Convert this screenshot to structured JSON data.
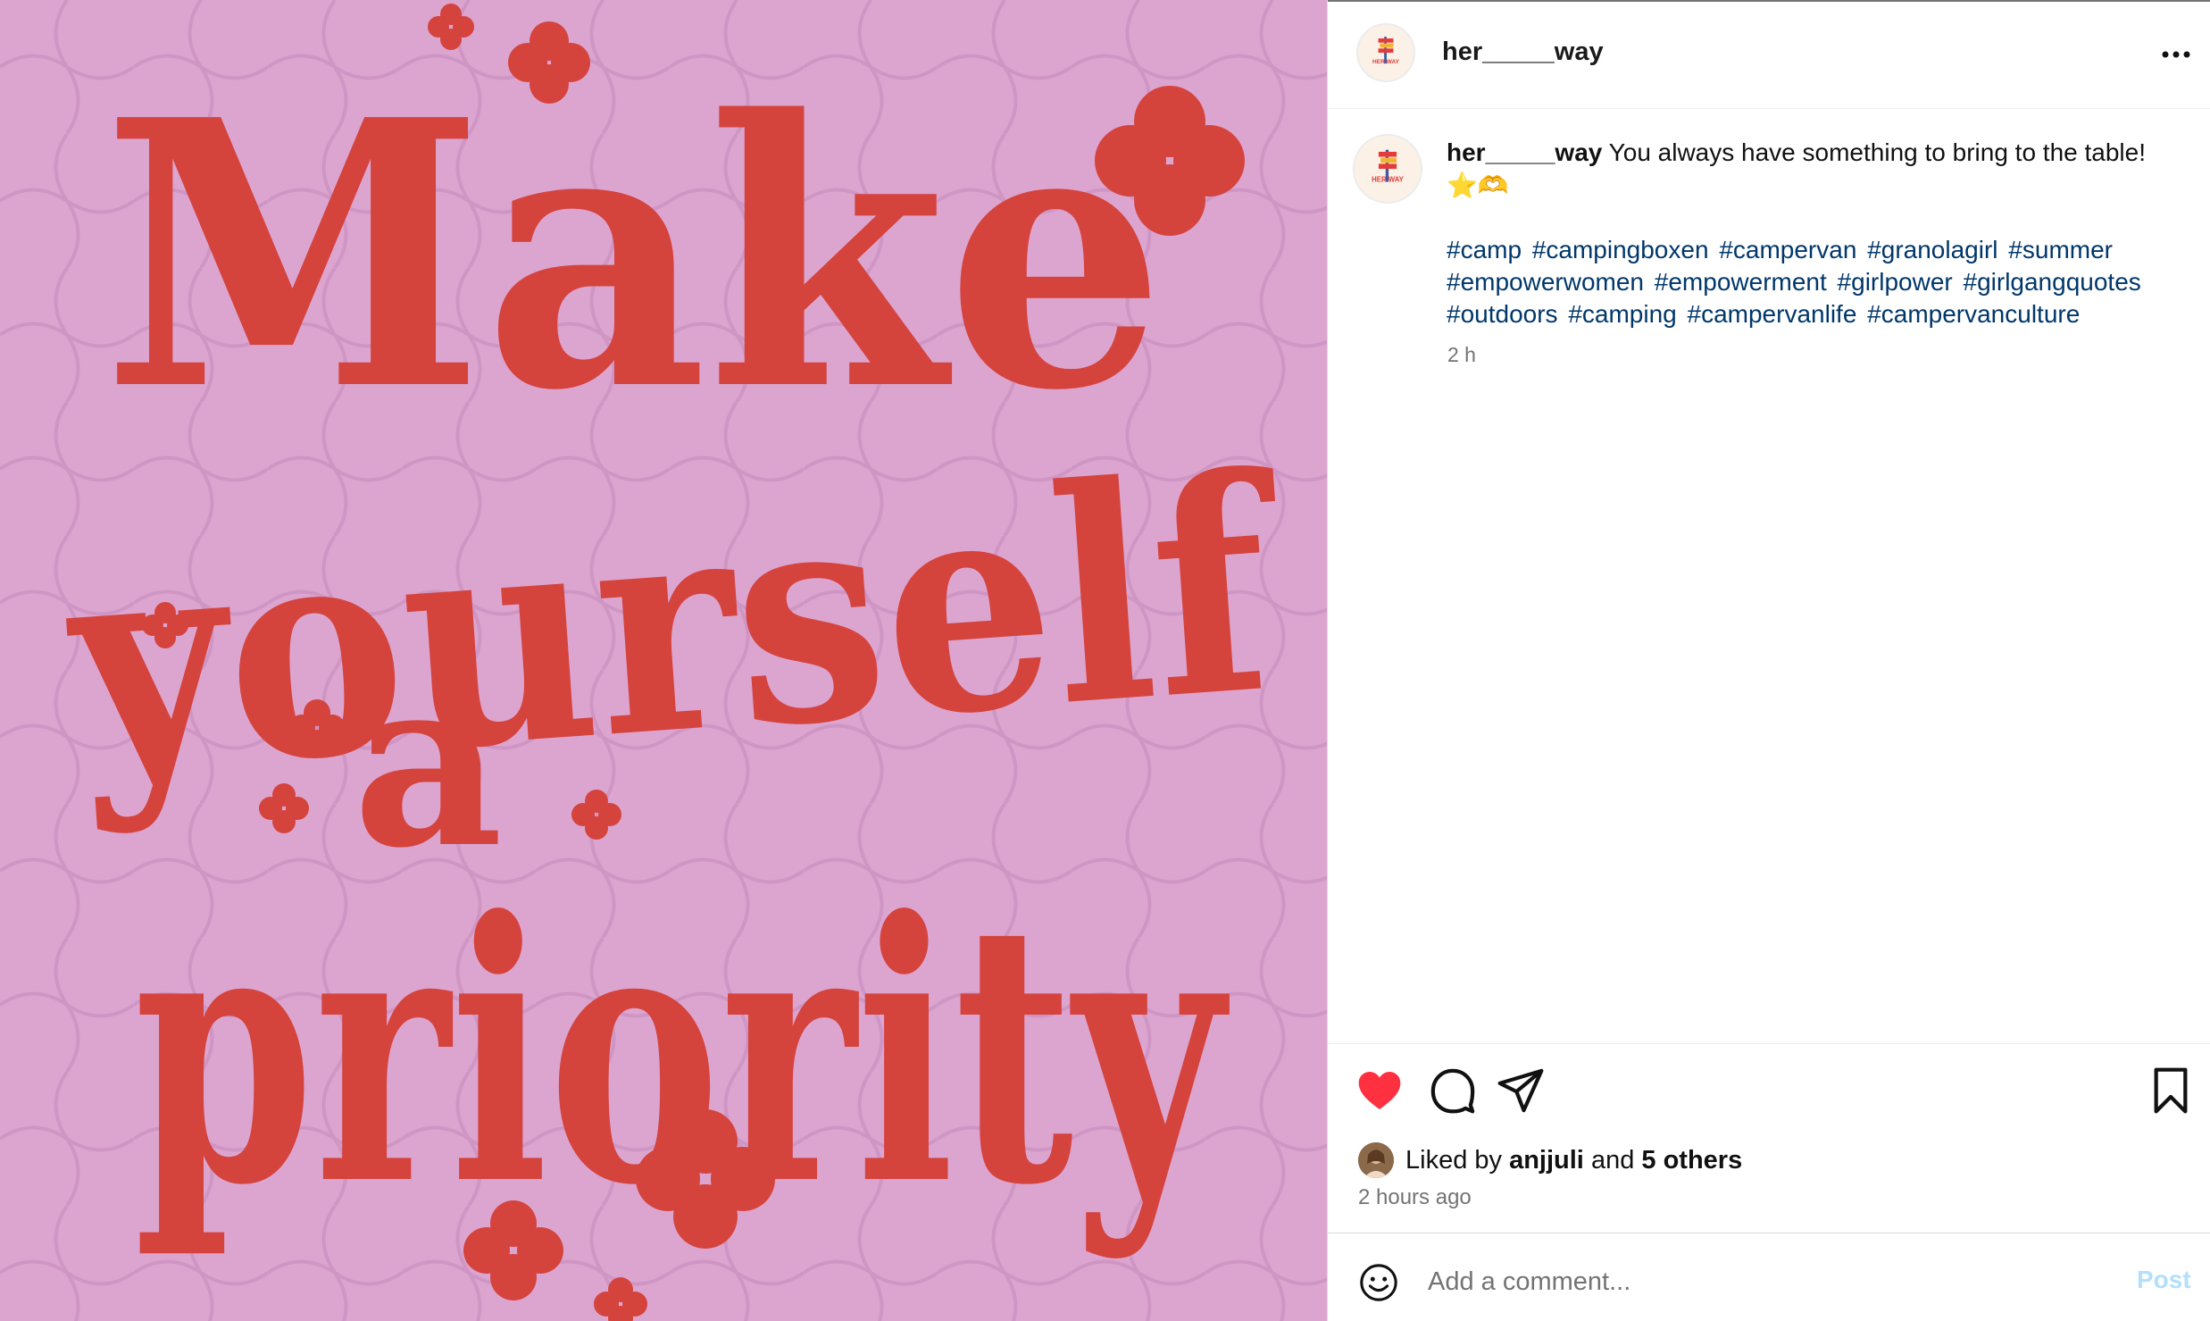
{
  "post": {
    "image": {
      "quote_line_1": "Make",
      "quote_line_2": "yourself",
      "quote_line_3": "a",
      "quote_line_4": "priority",
      "background_color": "#dca5cf",
      "text_color": "#d5433d"
    },
    "header": {
      "username": "her_____way",
      "avatar_logo_text": "HER WAY",
      "more_icon": "more-horizontal-icon"
    },
    "caption": {
      "username": "her_____way",
      "text": "You always have something to bring to the table! ⭐️🫶",
      "hashtags": [
        "#camp",
        "#campingboxen",
        "#campervan",
        "#granolagirl",
        "#summer",
        "#empowerwomen",
        "#empowerment",
        "#girlpower",
        "#girlgangquotes",
        "#outdoors",
        "#camping",
        "#campervanlife",
        "#campervanculture"
      ],
      "time": "2 h"
    },
    "actions": {
      "like_icon": "heart-filled-icon",
      "comment_icon": "comment-icon",
      "share_icon": "paper-plane-icon",
      "save_icon": "bookmark-icon",
      "like_color": "#ff3040"
    },
    "likes": {
      "prefix": "Liked by",
      "first_liker": "anjjuli",
      "connector": "and",
      "others": "5 others"
    },
    "timestamp": "2 hours ago",
    "comment_box": {
      "placeholder": "Add a comment...",
      "post_label": "Post",
      "emoji_icon": "smiley-icon"
    }
  }
}
